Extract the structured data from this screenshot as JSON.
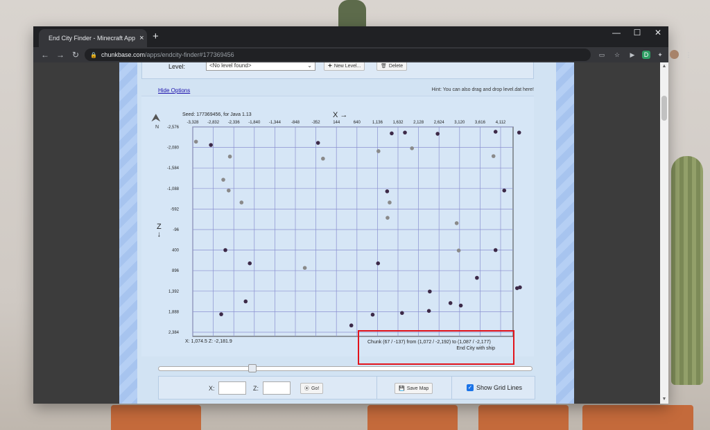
{
  "browser": {
    "tab_title": "End City Finder - Minecraft App",
    "tab_close": "×",
    "new_tab": "+",
    "win_min": "—",
    "win_max": "☐",
    "win_close": "✕",
    "url_host": "chunkbase.com",
    "url_path": "/apps/endcity-finder#177369456",
    "nav_back": "←",
    "nav_forward": "→",
    "nav_reload": "↻"
  },
  "level": {
    "label": "Level:",
    "select_value": "<No level found>",
    "new_button": "New Level...",
    "delete_button": "Delete"
  },
  "options": {
    "hide_options": "Hide Options",
    "hint": "Hint: You can also drag and drop level.dat here!"
  },
  "map": {
    "seed": "Seed: 177369456, for Java 1.13",
    "x_title": "X →",
    "z_title": "Z",
    "z_arrow": "↓",
    "north": "N",
    "x_ticks": [
      "-3,328",
      "-2,832",
      "-2,336",
      "-1,840",
      "-1,344",
      "-848",
      "-352",
      "144",
      "640",
      "1,136",
      "1,632",
      "2,128",
      "2,624",
      "3,120",
      "3,616",
      "4,112"
    ],
    "z_ticks": [
      "-2,576",
      "-2,080",
      "-1,584",
      "-1,088",
      "-592",
      "-96",
      "400",
      "896",
      "1,392",
      "1,888",
      "2,384"
    ],
    "cursor_readout": "X: 1,074.5   Z: -2,181.9",
    "info_line1": "Chunk (67 / -137) from (1,072 / -2,192) to (1,087 / -2,177)",
    "info_line2": "End City with ship",
    "colors": {
      "dark_dot": "#3d2a48",
      "gray_dot": "#8a8a8a",
      "grid": "#8a8fd0",
      "highlight": "#e2131b"
    },
    "cities_with_ship": [
      [
        -2890,
        -2140
      ],
      [
        -2540,
        400
      ],
      [
        -1950,
        720
      ],
      [
        -2050,
        1640
      ],
      [
        -2640,
        1950
      ],
      [
        -300,
        -2190
      ],
      [
        504,
        2220
      ],
      [
        1150,
        720
      ],
      [
        1800,
        -2440
      ],
      [
        1370,
        -1020
      ],
      [
        1020,
        1960
      ],
      [
        2900,
        1680
      ],
      [
        1730,
        1920
      ],
      [
        2400,
        1400
      ],
      [
        2380,
        1870
      ],
      [
        3990,
        -2460
      ],
      [
        3990,
        400
      ],
      [
        4560,
        -2440
      ],
      [
        1480,
        -2420
      ],
      [
        2590,
        -2410
      ],
      [
        4580,
        1300
      ],
      [
        3540,
        1070
      ],
      [
        3150,
        1740
      ],
      [
        4200,
        -1040
      ],
      [
        4510,
        1320
      ]
    ],
    "cities_without_ship": [
      [
        -3250,
        -2220
      ],
      [
        -2430,
        -1860
      ],
      [
        -2590,
        -1300
      ],
      [
        -2460,
        -1040
      ],
      [
        -2150,
        -750
      ],
      [
        -180,
        -1810
      ],
      [
        -620,
        830
      ],
      [
        1160,
        -1990
      ],
      [
        1430,
        -750
      ],
      [
        1380,
        -380
      ],
      [
        1970,
        -2060
      ],
      [
        3050,
        -250
      ],
      [
        3940,
        -1870
      ],
      [
        3100,
        410
      ]
    ]
  },
  "controls": {
    "x_label": "X:",
    "z_label": "Z:",
    "x_value": "",
    "z_value": "",
    "go_button": "Go!",
    "save_button": "Save Map",
    "grid_checkbox_label": "Show Grid Lines",
    "grid_checked": true,
    "zoom_slider_value": 0.25
  }
}
